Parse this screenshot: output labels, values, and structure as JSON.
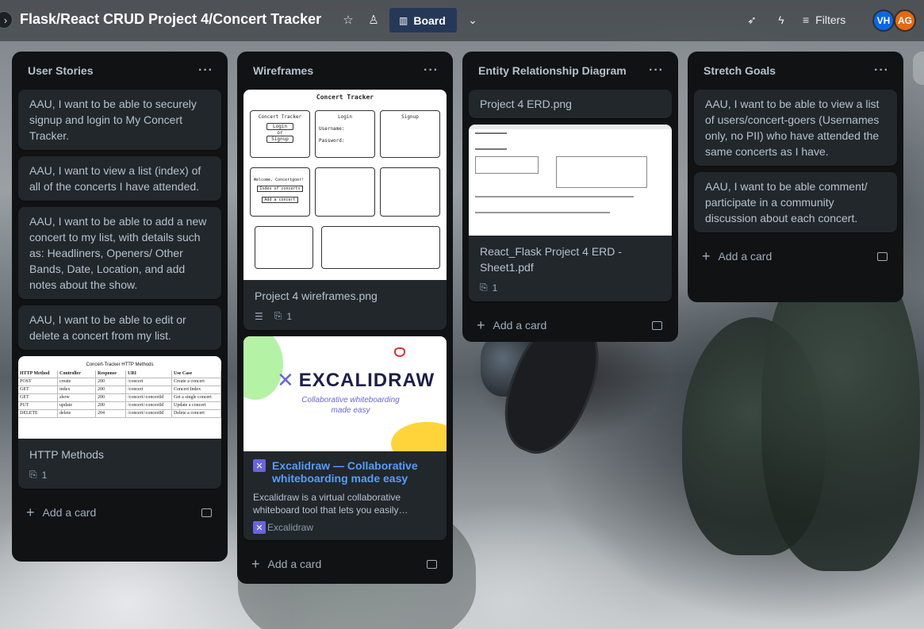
{
  "header": {
    "board_title": "Flask/React CRUD Project 4/Concert Tracker",
    "view_label": "Board",
    "filters_label": "Filters",
    "avatars": [
      {
        "initials": "VH",
        "color": "#0c66e4"
      },
      {
        "initials": "AG",
        "color": "#e56910"
      }
    ]
  },
  "lists": {
    "user_stories": {
      "title": "User Stories",
      "cards": [
        "AAU, I want to be able to securely signup and login to My Concert Tracker.",
        "AAU, I want to view a list (index) of all of the concerts I have attended.",
        "AAU, I want to be able to add a new concert to my list, with details such as: Headliners, Openers/ Other Bands, Date, Location, and add notes about the show.",
        "AAU, I want to be able to edit or delete a concert from my list."
      ],
      "http_card": {
        "title": "HTTP Methods",
        "attachments": "1",
        "sheet_title": "Concert-Tracker HTTP Methods",
        "columns": [
          "HTTP Method",
          "Controller",
          "Response",
          "URI",
          "Use Case"
        ],
        "rows": [
          [
            "POST",
            "create",
            "200",
            "/concert",
            "Create a concert"
          ],
          [
            "GET",
            "index",
            "200",
            "/concert",
            "Concert Index"
          ],
          [
            "GET",
            "show",
            "200",
            "/concert/:concertId",
            "Get a single concert"
          ],
          [
            "PUT",
            "update",
            "200",
            "/concert/:concertId",
            "Update a concert"
          ],
          [
            "DELETE",
            "delete",
            "204",
            "/concert/:concertId",
            "Delete a concert"
          ]
        ]
      },
      "add_label": "Add a card"
    },
    "wireframes": {
      "title": "Wireframes",
      "wire_card": {
        "title": "Project 4 wireframes.png",
        "attachments": "1",
        "app_title": "Concert Tracker",
        "login": "Login",
        "signup": "Signup",
        "or": "or",
        "username": "Username:",
        "password": "Password:",
        "index_label": "Index of concerts",
        "add_concert": "Add a concert",
        "welcome": "Welcome, Concertgoer!"
      },
      "link_card": {
        "brand": "EXCALIDRAW",
        "tagline": "Collaborative whiteboarding made easy",
        "title": "Excalidraw — Collaborative whiteboarding made easy",
        "description": "Excalidraw is a virtual collaborative whiteboard tool that lets you easily…",
        "site": "Excalidraw"
      },
      "add_label": "Add a card"
    },
    "erd": {
      "title": "Entity Relationship Diagram",
      "cards": [
        "Project 4 ERD.png"
      ],
      "pdf_card": {
        "title": "React_Flask Project 4 ERD - Sheet1.pdf",
        "attachments": "1"
      },
      "add_label": "Add a card"
    },
    "stretch": {
      "title": "Stretch Goals",
      "cards": [
        "AAU, I want to be able to view a list of users/concert-goers (Usernames only, no PII) who have attended the same concerts as I have.",
        "AAU, I want to be able comment/ participate in a community discussion about each concert."
      ],
      "add_label": "Add a card"
    }
  }
}
